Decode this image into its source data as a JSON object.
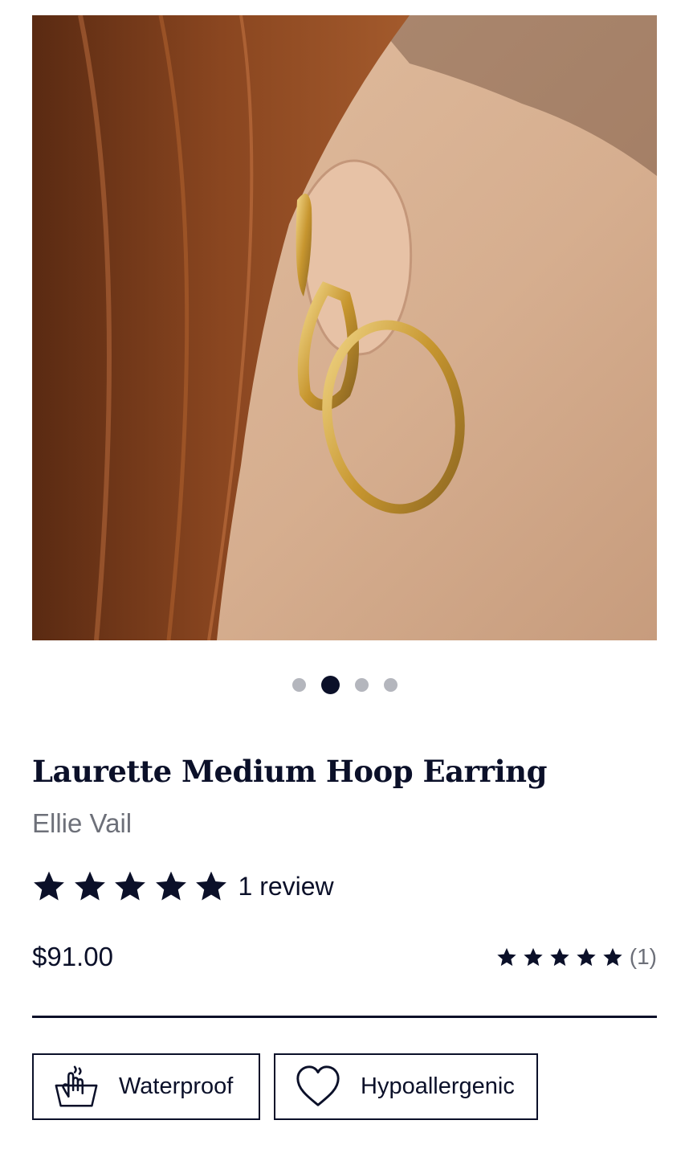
{
  "gallery": {
    "image_alt": "Model wearing gold hoop earrings",
    "dots": 4,
    "active_index": 1
  },
  "product": {
    "title": "Laurette Medium Hoop Earring",
    "brand": "Ellie Vail",
    "rating": 5,
    "review_label": "1 review",
    "price": "$91.00",
    "mini_rating_count": "(1)"
  },
  "badges": [
    {
      "icon": "water-basin-hand-icon",
      "label": "Waterproof"
    },
    {
      "icon": "heart-icon",
      "label": "Hypoallergenic"
    }
  ],
  "colors": {
    "text": "#0b1029",
    "muted": "#6d7079",
    "dot_inactive": "#b4b6bd",
    "dot_active": "#0b1029"
  }
}
